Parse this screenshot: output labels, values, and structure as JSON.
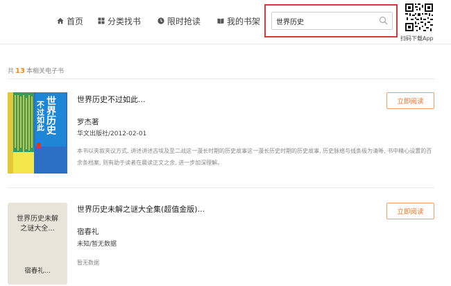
{
  "nav": {
    "items": [
      {
        "label": "首页",
        "icon": "home-icon"
      },
      {
        "label": "分类找书",
        "icon": "grid-icon"
      },
      {
        "label": "限时抢读",
        "icon": "clock-icon"
      },
      {
        "label": "我的书架",
        "icon": "book-icon"
      }
    ]
  },
  "search": {
    "value": "世界历史",
    "icon": "search-icon"
  },
  "qr": {
    "label": "扫码下载App"
  },
  "results": {
    "prefix": "共",
    "count": "13",
    "suffix": "本相关电子书"
  },
  "books": [
    {
      "title": "世界历史不过如此...",
      "author": "罗杰著",
      "publisher": "华文出版社/2012-02-01",
      "description": "本书以夹叙夹议方式, 讲述讲述古埃及至二战这一漫长时期的历史故事这一漫长历史时期的历史故事, 历史脉络与线条极为清晰, 书中精心设置的百余条档案, 则有助于读者在晨读正文之余, 进一步加深理解。",
      "read_label": "立即阅读",
      "cover": {
        "title_lines": [
          "世界历史",
          "不过如此"
        ]
      }
    },
    {
      "title": "世界历史未解之谜大全集(超值金版)...",
      "author": "宿春礼",
      "publisher": "未知/暂无数据",
      "description": "暂无数据",
      "read_label": "立即阅读",
      "cover": {
        "title_lines": [
          "世界历史未解",
          "之谜大全..."
        ],
        "author": "宿春礼..."
      }
    }
  ],
  "colors": {
    "accent": "#e8742a",
    "highlight_border": "#d43a3a",
    "count": "#f08a1e"
  }
}
